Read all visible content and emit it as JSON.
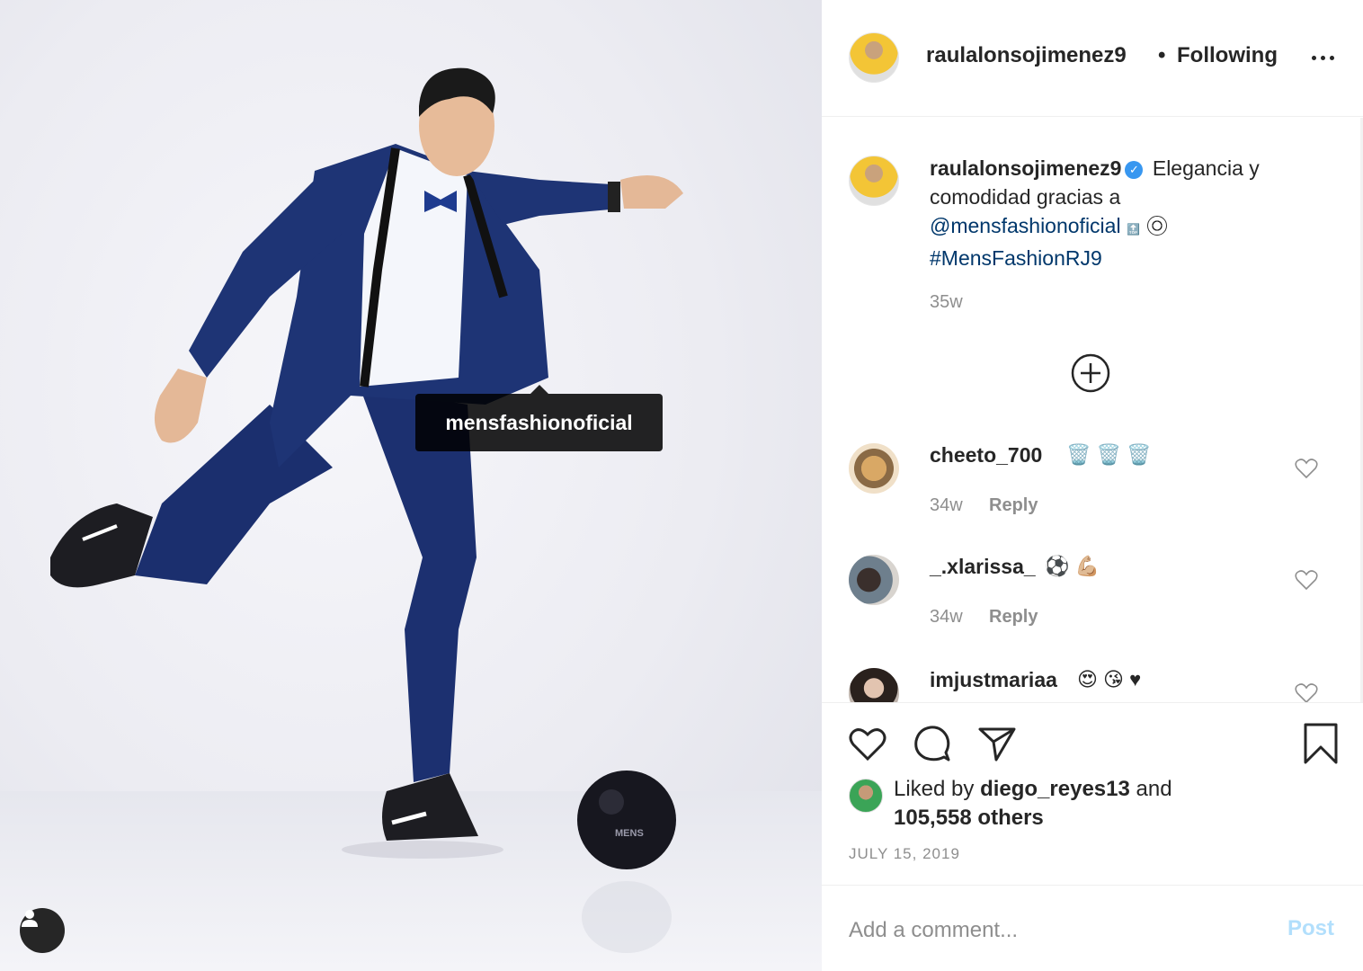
{
  "post": {
    "photo_tag": "mensfashionoficial",
    "ball_text": "MENS"
  },
  "header": {
    "username": "raulalonsojimenez9",
    "separator": "•",
    "follow_status": "Following"
  },
  "caption": {
    "username": "raulalonsojimenez9",
    "text": "Elegancia y comodidad gracias a",
    "mention": "@mensfashionoficial",
    "emoji_top": "🔝",
    "hashtag": "#MensFashionRJ9",
    "time": "35w"
  },
  "comments": [
    {
      "username": "cheeto_700",
      "emoji": "🗑️ 🗑️ 🗑️",
      "time": "34w",
      "reply": "Reply"
    },
    {
      "username": "_.xlarissa_",
      "emoji": "⚽ 💪🏼",
      "time": "34w",
      "reply": "Reply"
    },
    {
      "username": "imjustmariaa",
      "emoji": "😍 😘 ♥",
      "time": "",
      "reply": ""
    }
  ],
  "likes": {
    "prefix": "Liked by",
    "user": "diego_reyes13",
    "and": "and",
    "others": "105,558 others"
  },
  "date": "JULY 15, 2019",
  "add_comment": {
    "placeholder": "Add a comment...",
    "post_label": "Post"
  },
  "colors": {
    "accent": "#3897f0",
    "link": "#00376b",
    "muted": "#8e8e8e",
    "post_disabled": "#b2dffc"
  }
}
